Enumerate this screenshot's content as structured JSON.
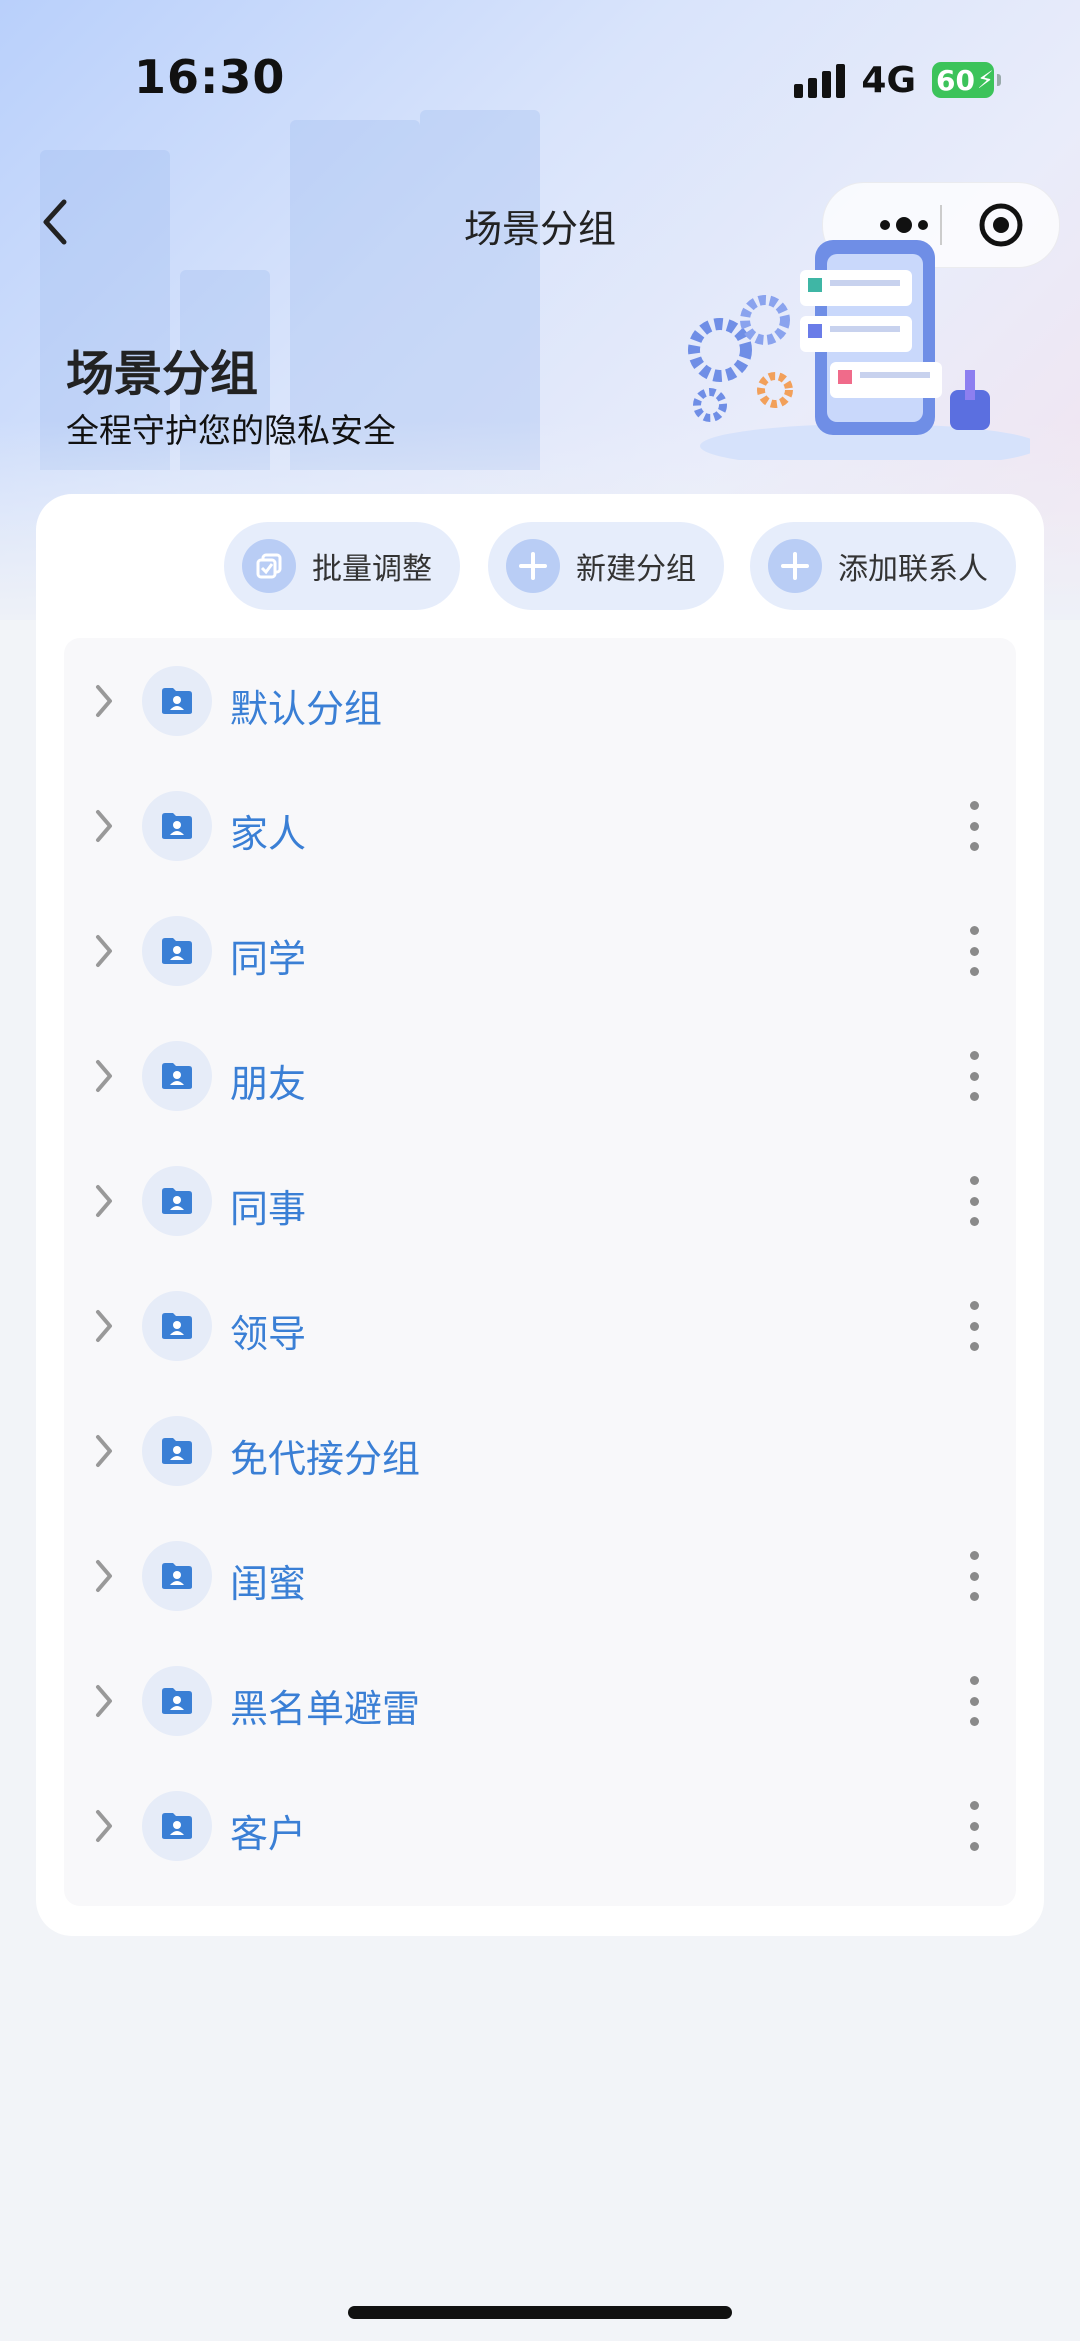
{
  "status": {
    "time": "16:30",
    "network": "4G",
    "battery": "60"
  },
  "nav": {
    "title": "场景分组"
  },
  "hero": {
    "title": "场景分组",
    "subtitle": "全程守护您的隐私安全"
  },
  "actions": [
    {
      "label": "批量调整",
      "icon": "batch-icon"
    },
    {
      "label": "新建分组",
      "icon": "plus-icon"
    },
    {
      "label": "添加联系人",
      "icon": "plus-icon"
    }
  ],
  "groups": [
    {
      "name": "默认分组",
      "has_menu": false
    },
    {
      "name": "家人",
      "has_menu": true
    },
    {
      "name": "同学",
      "has_menu": true
    },
    {
      "name": "朋友",
      "has_menu": true
    },
    {
      "name": "同事",
      "has_menu": true
    },
    {
      "name": "领导",
      "has_menu": true
    },
    {
      "name": "免代接分组",
      "has_menu": false
    },
    {
      "name": "闺蜜",
      "has_menu": true
    },
    {
      "name": "黑名单避雷",
      "has_menu": true
    },
    {
      "name": "客户",
      "has_menu": true
    }
  ],
  "colors": {
    "accent": "#3a7fd5",
    "pill_bg": "#e6edfb",
    "battery": "#3cc35a"
  }
}
